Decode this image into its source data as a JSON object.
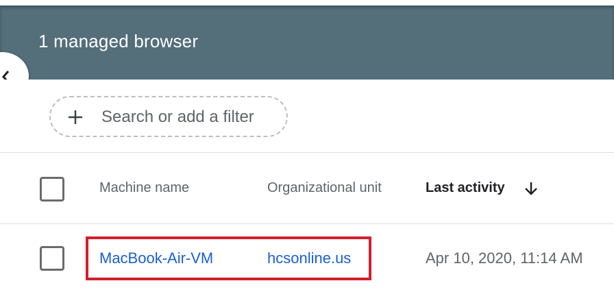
{
  "header": {
    "title": "1 managed browser"
  },
  "filter": {
    "placeholder": "Search or add a filter"
  },
  "table": {
    "columns": {
      "machine_name": "Machine name",
      "org_unit": "Organizational unit",
      "last_activity": "Last activity"
    },
    "sort": {
      "column": "last_activity",
      "direction": "descending",
      "icon": "arrow-down-icon"
    },
    "rows": [
      {
        "machine_name": "MacBook-Air-VM",
        "org_unit": "hcsonline.us",
        "last_activity": "Apr 10, 2020, 11:14 AM",
        "selected": false
      }
    ]
  },
  "colors": {
    "header_bg": "#546e7a",
    "link": "#1a5fd1",
    "highlight_border": "#d11f2e"
  },
  "icons": [
    "chevron-left-icon",
    "plus-icon",
    "arrow-down-icon"
  ]
}
